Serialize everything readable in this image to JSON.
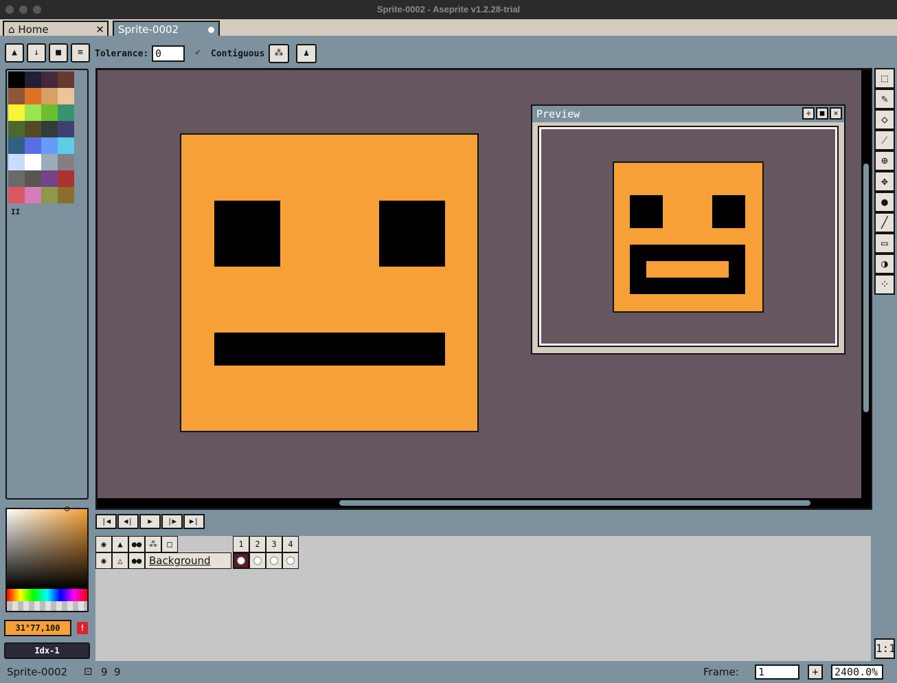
{
  "window": {
    "title": "Sprite-0002 - Aseprite v1.2.28-trial"
  },
  "tabs": [
    {
      "label": "Home",
      "icon": "home-icon",
      "close": "✕"
    },
    {
      "label": "Sprite-0002",
      "icon": "modified-dot-icon"
    }
  ],
  "context_bar": {
    "tolerance_label": "Tolerance:",
    "tolerance_value": "0",
    "contiguous_label": "Contiguous",
    "contiguous_checked": true
  },
  "palette": {
    "colors": [
      "#000000",
      "#222034",
      "#45283c",
      "#663931",
      "#8f563b",
      "#df7126",
      "#d9a066",
      "#eec39a",
      "#fbf236",
      "#99e550",
      "#6abe30",
      "#37946e",
      "#4b692f",
      "#524b24",
      "#323c39",
      "#3f3f74",
      "#306082",
      "#5b6ee1",
      "#639bff",
      "#5fcde4",
      "#cbdbfc",
      "#ffffff",
      "#9badb7",
      "#847e87",
      "#696a6a",
      "#595652",
      "#76428a",
      "#ac3232",
      "#d95763",
      "#d77bba",
      "#8f974a",
      "#8a6f30"
    ],
    "pause_label": "II"
  },
  "canvas": {
    "background": "#655660",
    "sprite_color": "#f7a037"
  },
  "preview": {
    "title": "Preview"
  },
  "timeline": {
    "layer_name": "Background",
    "frames": [
      "1",
      "2",
      "3",
      "4"
    ],
    "current_frame": "1"
  },
  "color": {
    "fg_value": "31°77,100",
    "index_label": "Idx-1",
    "fg_hex": "#f7a037",
    "warning": "!"
  },
  "status": {
    "sprite_name": "Sprite-0002",
    "size_w": "9",
    "size_h": "9",
    "frame_label": "Frame:",
    "frame_value": "1",
    "add_label": "+",
    "zoom_value": "2400.0%",
    "ratio_label": "1:1"
  }
}
